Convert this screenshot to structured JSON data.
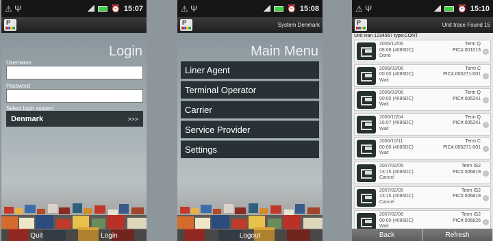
{
  "status_left_glyphs": "⚠ Ψ",
  "screens": [
    {
      "time": "15:07",
      "heading": "Login",
      "username_label": "Username",
      "password_label": "Password",
      "system_label": "Select login system",
      "system_value": "Denmark",
      "system_arrow": ">>>",
      "bottom_left": "Quit",
      "bottom_right": "Login"
    },
    {
      "time": "15:08",
      "title": "System Denmark",
      "heading": "Main Menu",
      "items": [
        "Liner Agent",
        "Terminal Operator",
        "Carrier",
        "Service Provider",
        "Settings"
      ],
      "bottom": "Logout"
    },
    {
      "time": "15:10",
      "title": "Unit trace Found 15",
      "unit_line": "Unit ivan 1234567 type:CONT",
      "rows": [
        {
          "date": "2005/12/06",
          "time": "08:08 (4086DC)",
          "status": "Done",
          "term": "Term Q",
          "pic": "PIC#.001013"
        },
        {
          "date": "2006/03/08",
          "time": "00:00 (4086DC)",
          "status": "Wait",
          "term": "Term C",
          "pic": "PIC#.005271-001"
        },
        {
          "date": "2006/03/08",
          "time": "00:00 (4086DC)",
          "status": "Wait",
          "term": "Term Q",
          "pic": "PIC#.005241"
        },
        {
          "date": "2006/10/04",
          "time": "16:07 (4086DC)",
          "status": "Wait",
          "term": "Term Q",
          "pic": "PIC#.005241"
        },
        {
          "date": "2006/10/11",
          "time": "00:00 (4086DC)",
          "status": "Wait",
          "term": "Term C",
          "pic": "PIC#.005271-001"
        },
        {
          "date": "2007/02/05",
          "time": "13:15 (4086DC)",
          "status": "Cancel",
          "term": "Term IS2",
          "pic": "PIC#.006819"
        },
        {
          "date": "2007/02/05",
          "time": "13:15 (4086DC)",
          "status": "Cancel",
          "term": "Term IS2",
          "pic": "PIC#.006819"
        },
        {
          "date": "2007/02/06",
          "time": "00:00 (4086DC)",
          "status": "Wait",
          "term": "Term IS2",
          "pic": "PIC#.006826"
        }
      ],
      "back_label": "Back",
      "refresh_label": "Refresh"
    }
  ]
}
